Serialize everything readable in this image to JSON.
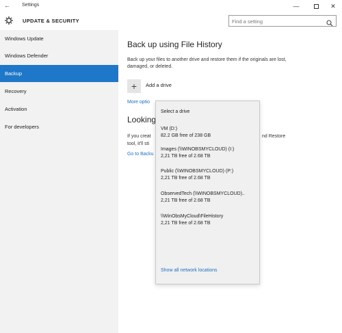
{
  "window": {
    "back_glyph": "←",
    "title": "Settings",
    "min_glyph": "—",
    "close_glyph": "✕"
  },
  "header": {
    "section_title": "UPDATE & SECURITY",
    "search_placeholder": "Find a setting"
  },
  "sidebar": {
    "items": [
      {
        "label": "Windows Update"
      },
      {
        "label": "Windows Defender"
      },
      {
        "label": "Backup"
      },
      {
        "label": "Recovery"
      },
      {
        "label": "Activation"
      },
      {
        "label": "For developers"
      }
    ],
    "selected": "Backup"
  },
  "main": {
    "heading": "Back up using File History",
    "description": "Back up your files to another drive and restore them if the originals are lost, damaged, or deleted.",
    "add_drive_glyph": "+",
    "add_drive_label": "Add a drive",
    "more_options": "More optio",
    "heading2": "Looking",
    "desc2_line1": "If you creat",
    "desc2_line2": "tool, it'll sti",
    "desc2_right": "nd Restore",
    "goto_link": "Go to Backu"
  },
  "flyout": {
    "title": "Select a drive",
    "drives": [
      {
        "name": "VM (D:)",
        "free": "82.2 GB free of 238 GB"
      },
      {
        "name": "Images (\\\\WINOBSMYCLOUD) (I:)",
        "free": "2,21 TB free of 2.68 TB"
      },
      {
        "name": "Public (\\\\WINOBSMYCLOUD) (P:)",
        "free": "2,21 TB free of 2.68 TB"
      },
      {
        "name": "ObservedTech (\\\\WINOBSMYCLOUD)..",
        "free": "2,21 TB free of 2.68 TB"
      },
      {
        "name": "\\\\WinObsMyCloud\\FileHistory",
        "free": "2,21 TB free of 2.68 TB"
      }
    ],
    "show_all": "Show all network locations"
  },
  "colors": {
    "accent": "#1f77c9",
    "link": "#1f6fc2",
    "sidebar_bg": "#f2f2f2",
    "flyout_bg": "#f0f0f0"
  },
  "icons": [
    "back-arrow-icon",
    "gear-icon",
    "search-icon",
    "plus-icon",
    "minimize-icon",
    "maximize-icon",
    "close-icon"
  ]
}
